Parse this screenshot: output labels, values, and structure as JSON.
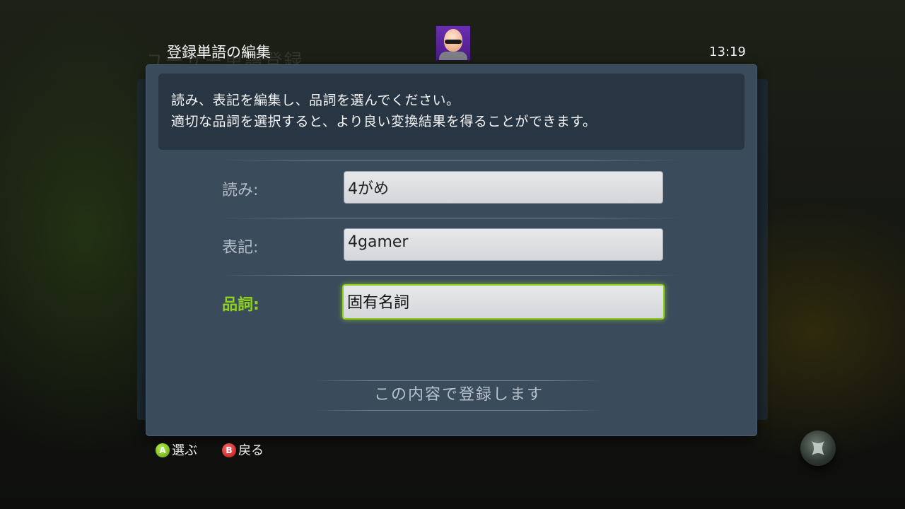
{
  "header": {
    "background_title": "ユーザー単語登録",
    "title": "登録単語の編集",
    "clock": "13:19"
  },
  "dialog": {
    "info_lines": [
      "読み、表記を編集し、品詞を選んでください。",
      "適切な品詞を選択すると、より良い変換結果を得ることができます。"
    ],
    "fields": [
      {
        "label": "読み:",
        "value": "4がめ"
      },
      {
        "label": "表記:",
        "value": "4gamer"
      },
      {
        "label": "品詞:",
        "value": "固有名詞"
      }
    ],
    "register_label": "この内容で登録します"
  },
  "footer": {
    "a_glyph": "A",
    "a_label": "選ぶ",
    "b_glyph": "B",
    "b_label": "戻る"
  },
  "colors": {
    "accent": "#8fd21e",
    "dialog_bg": "#3a4b5c",
    "info_bg": "#283543",
    "a_button": "#6ab51a",
    "b_button": "#d11f1f"
  },
  "icons": [
    "avatar",
    "a-button-icon",
    "b-button-icon",
    "xbox-logo-icon"
  ]
}
